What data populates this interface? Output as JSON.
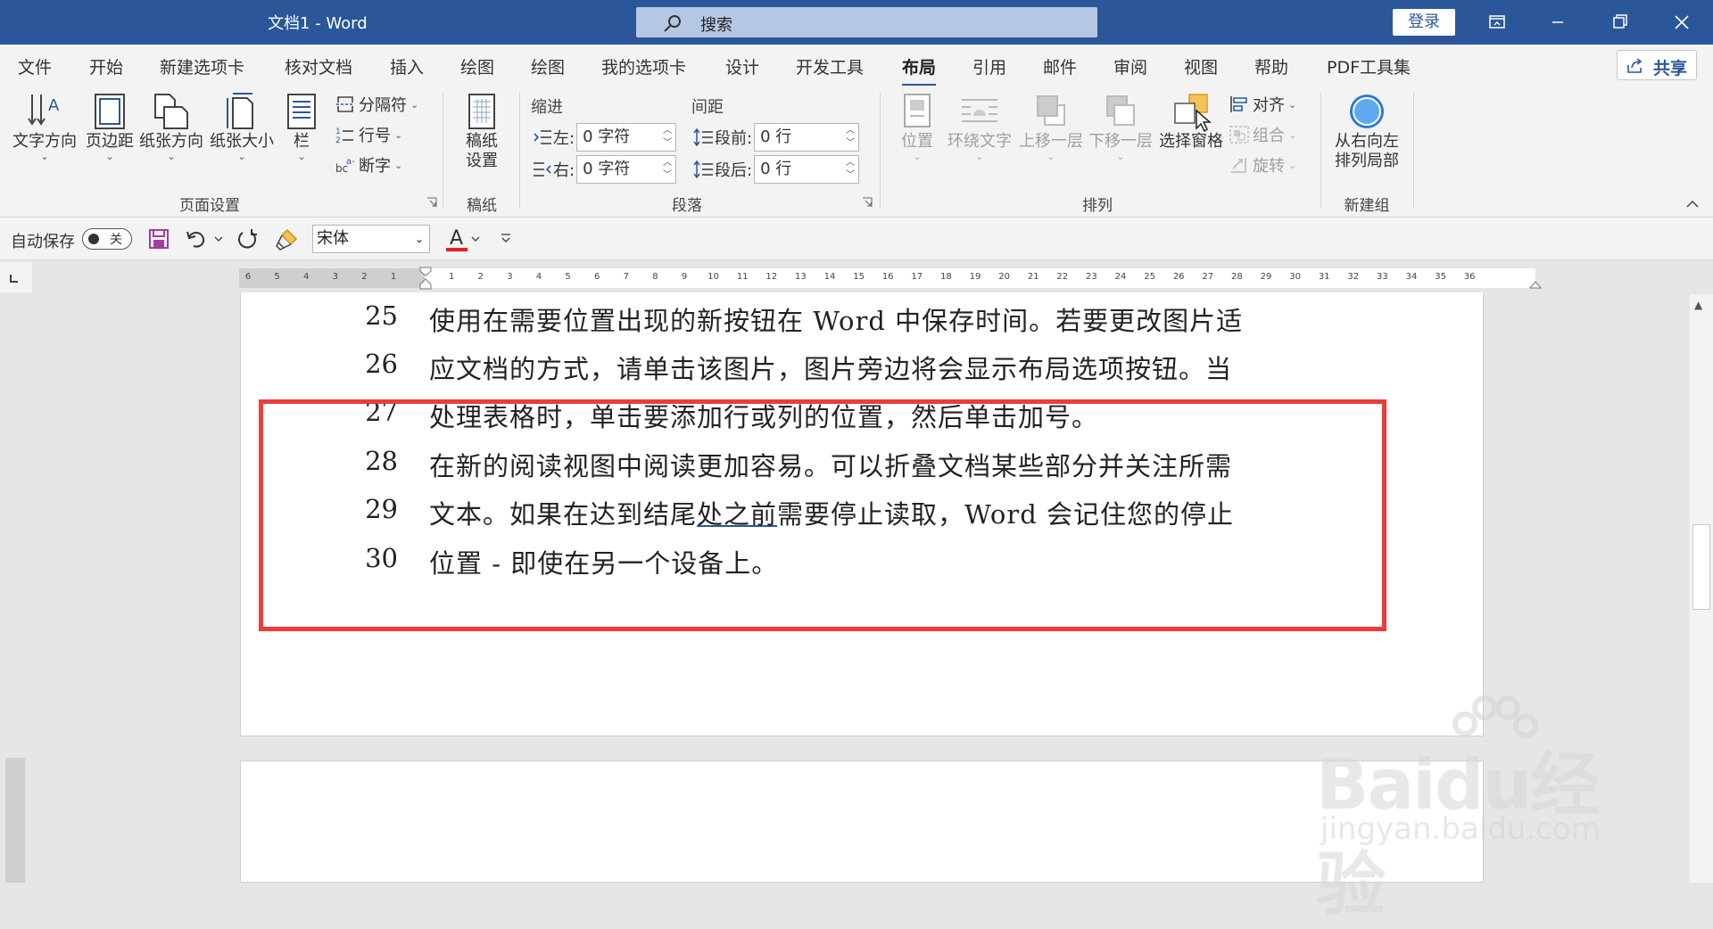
{
  "titlebar": {
    "doc_title": "文档1  -  Word",
    "search_placeholder": "搜索",
    "login_label": "登录"
  },
  "tabs": [
    "文件",
    "开始",
    "新建选项卡",
    "核对文档",
    "插入",
    "绘图",
    "绘图",
    "我的选项卡",
    "设计",
    "开发工具",
    "布局",
    "引用",
    "邮件",
    "审阅",
    "视图",
    "帮助",
    "PDF工具集"
  ],
  "active_tab": "布局",
  "share_label": "共享",
  "ribbon": {
    "page_setup": {
      "text_direction": "文字方向",
      "margins": "页边距",
      "orientation": "纸张方向",
      "size": "纸张大小",
      "columns": "栏",
      "breaks": "分隔符",
      "line_numbers": "行号",
      "hyphenation": "断字",
      "group": "页面设置"
    },
    "manuscript": {
      "setup": "稿纸设置",
      "group": "稿纸"
    },
    "paragraph": {
      "indent_title": "缩进",
      "spacing_title": "间距",
      "left_label": "左:",
      "left_value": "0 字符",
      "right_label": "右:",
      "right_value": "0 字符",
      "before_label": "段前:",
      "before_value": "0 行",
      "after_label": "段后:",
      "after_value": "0 行",
      "group": "段落"
    },
    "arrange": {
      "position": "位置",
      "wrap_text": "环绕文字",
      "bring_forward": "上移一层",
      "send_backward": "下移一层",
      "selection_pane": "选择窗格",
      "align": "对齐",
      "group_btn": "组合",
      "rotate": "旋转",
      "group": "排列"
    },
    "new_group": {
      "rtl": "从右向左排列局部",
      "group": "新建组"
    }
  },
  "qat": {
    "autosave_label": "自动保存",
    "autosave_state": "关",
    "font_name": "宋体"
  },
  "ruler_ticks": [
    "6",
    "5",
    "4",
    "3",
    "2",
    "1",
    "",
    "1",
    "2",
    "3",
    "4",
    "5",
    "6",
    "7",
    "8",
    "9",
    "10",
    "11",
    "12",
    "13",
    "14",
    "15",
    "16",
    "17",
    "18",
    "19",
    "20",
    "21",
    "22",
    "23",
    "24",
    "25",
    "26",
    "27",
    "28",
    "29",
    "30",
    "31",
    "32",
    "33",
    "34",
    "35",
    "36"
  ],
  "document": {
    "lines": [
      {
        "num": "25",
        "text": "使用在需要位置出现的新按钮在 Word 中保存时间。若要更改图片适"
      },
      {
        "num": "26",
        "text": "应文档的方式，请单击该图片，图片旁边将会显示布局选项按钮。当"
      },
      {
        "num": "27",
        "text": "处理表格时，单击要添加行或列的位置，然后单击加号。"
      },
      {
        "num": "28",
        "text": "在新的阅读视图中阅读更加容易。可以折叠文档某些部分并关注所需"
      },
      {
        "num": "29",
        "text_before": "文本。如果在达到结尾",
        "text_underlined": "处之前",
        "text_after": "需要停止读取，Word  会记住您的停止"
      },
      {
        "num": "30",
        "text": "位置 - 即使在另一个设备上。"
      }
    ]
  },
  "watermark": {
    "brand": "Baidu经验",
    "url": "jingyan.baidu.com"
  },
  "colors": {
    "titlebar": "#2b579a",
    "highlight_box": "#ef3b3b"
  }
}
